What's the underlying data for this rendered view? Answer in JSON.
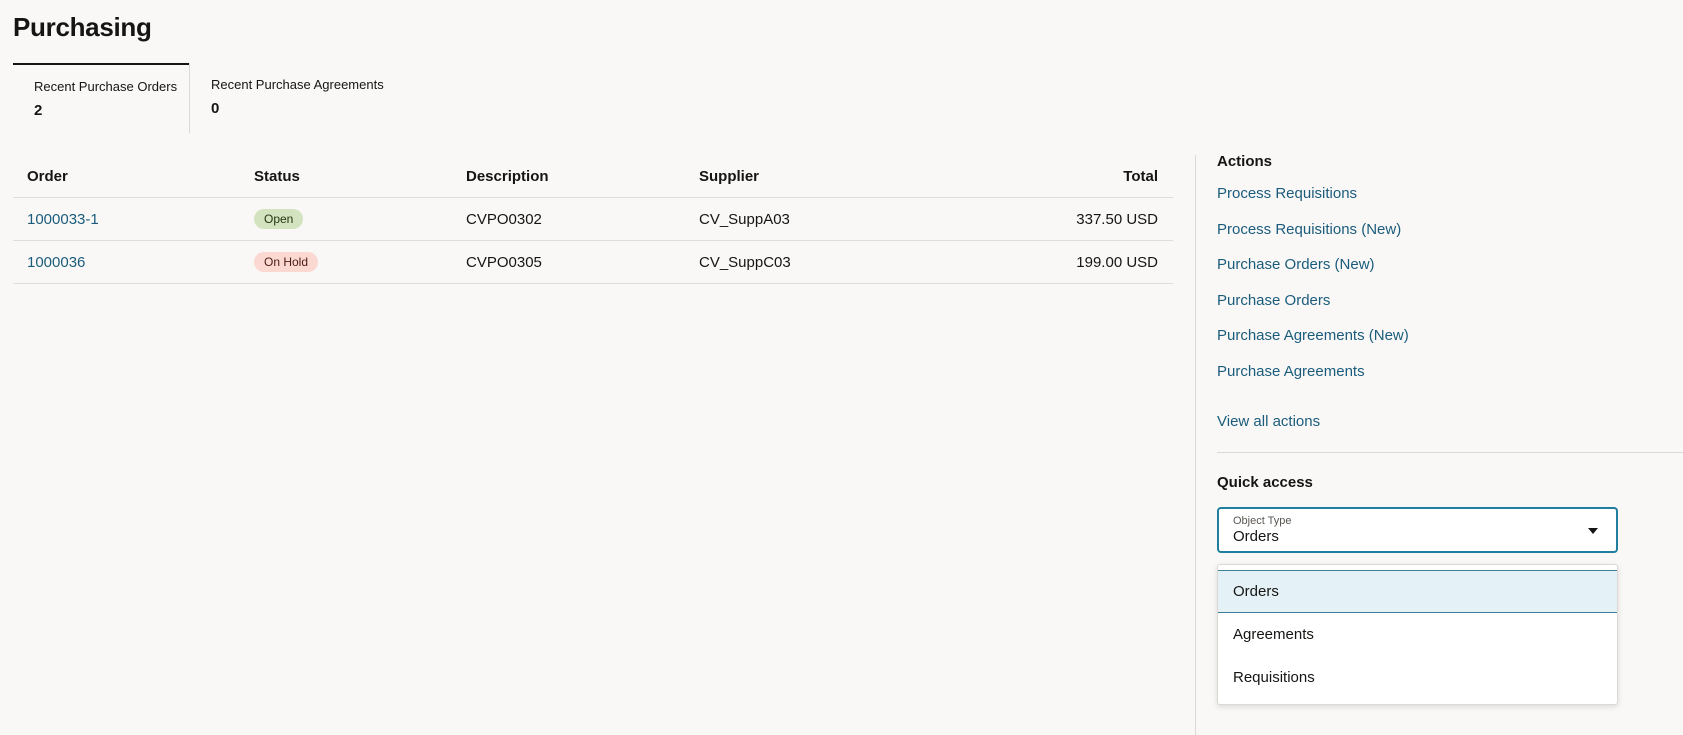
{
  "page": {
    "title": "Purchasing"
  },
  "tabs": [
    {
      "label": "Recent Purchase Orders",
      "count": "2"
    },
    {
      "label": "Recent Purchase Agreements",
      "count": "0"
    }
  ],
  "table": {
    "headers": {
      "order": "Order",
      "status": "Status",
      "description": "Description",
      "supplier": "Supplier",
      "total": "Total"
    },
    "rows": [
      {
        "order": "1000033-1",
        "status": "Open",
        "description": "CVPO0302",
        "supplier": "CV_SuppA03",
        "total": "337.50 USD"
      },
      {
        "order": "1000036",
        "status": "On Hold",
        "description": "CVPO0305",
        "supplier": "CV_SuppC03",
        "total": "199.00 USD"
      }
    ]
  },
  "actions": {
    "title": "Actions",
    "items": [
      "Process Requisitions",
      "Process Requisitions (New)",
      "Purchase Orders (New)",
      "Purchase Orders",
      "Purchase Agreements (New)",
      "Purchase Agreements"
    ],
    "view_all": "View all actions"
  },
  "quick_access": {
    "title": "Quick access",
    "select_label": "Object Type",
    "select_value": "Orders",
    "options": [
      "Orders",
      "Agreements",
      "Requisitions"
    ]
  },
  "colors": {
    "link": "#1b5c7c",
    "focus_border": "#227e9e",
    "badge_open_bg": "#d4e3bf",
    "badge_hold_bg": "#fbd8d2",
    "selected_option_bg": "#e4f1f7"
  }
}
